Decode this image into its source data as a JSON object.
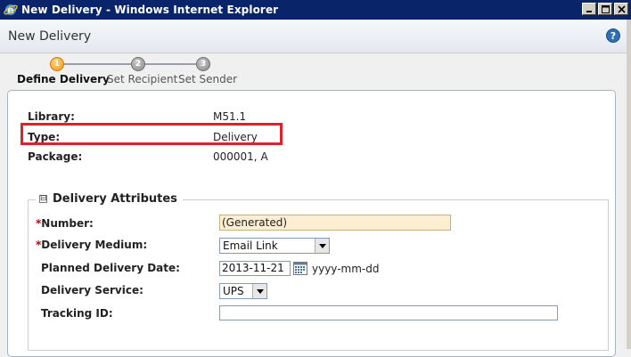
{
  "window": {
    "title": "New Delivery - Windows Internet Explorer"
  },
  "header": {
    "title": "New Delivery",
    "help_icon": "help-icon",
    "help_glyph": "?"
  },
  "wizard": {
    "steps": [
      {
        "number": "1",
        "label": "Define Delivery",
        "state": "active"
      },
      {
        "number": "2",
        "label": "Set Recipient",
        "state": "todo"
      },
      {
        "number": "3",
        "label": "Set Sender",
        "state": "todo"
      }
    ]
  },
  "info": [
    {
      "label": "Library:",
      "value": "M51.1"
    },
    {
      "label": "Type:",
      "value": "Delivery"
    },
    {
      "label": "Package:",
      "value": "000001, A"
    }
  ],
  "delivery_attributes": {
    "legend": "Delivery Attributes",
    "collapse_glyph": "⊟",
    "fields": {
      "number": {
        "label": "Number:",
        "required": "*",
        "value": "(Generated)"
      },
      "medium": {
        "label": "Delivery Medium:",
        "required": "*",
        "value": "Email Link"
      },
      "planned_date": {
        "label": "Planned Delivery Date:",
        "value": "2013-11-21",
        "hint": "yyyy-mm-dd"
      },
      "service": {
        "label": "Delivery Service:",
        "value": "UPS"
      },
      "tracking": {
        "label": "Tracking ID:",
        "value": ""
      }
    }
  },
  "colors": {
    "title_bar": "#0a246a",
    "active_step": "#f29a12",
    "highlight": "#e0202a",
    "required": "#c00000"
  }
}
